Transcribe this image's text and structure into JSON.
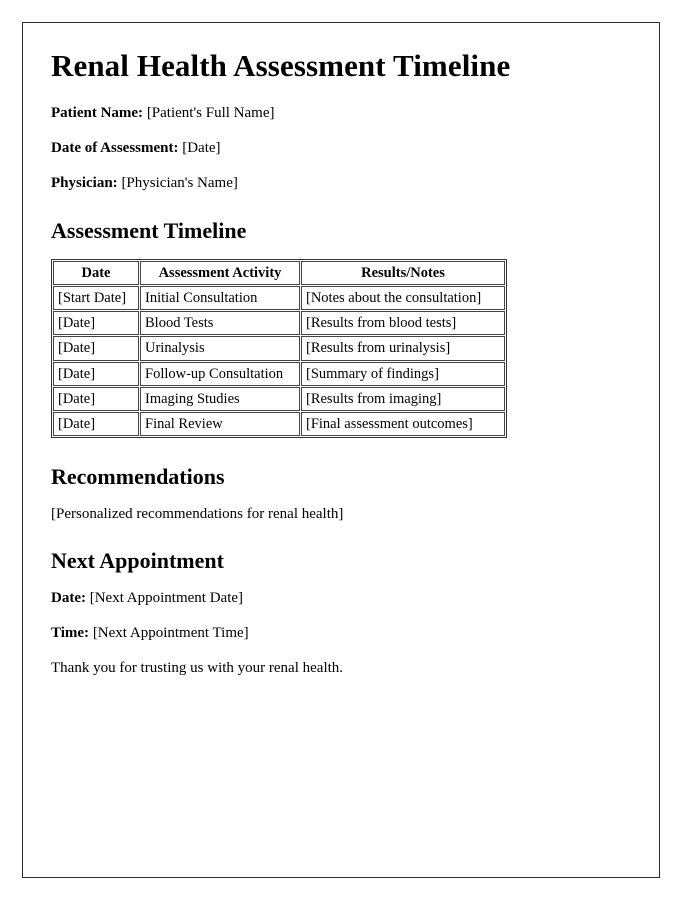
{
  "document": {
    "title": "Renal Health Assessment Timeline",
    "meta": [
      {
        "label": "Patient Name:",
        "value": "[Patient's Full Name]"
      },
      {
        "label": "Date of Assessment:",
        "value": "[Date]"
      },
      {
        "label": "Physician:",
        "value": "[Physician's Name]"
      }
    ],
    "timeline_section": {
      "heading": "Assessment Timeline",
      "table": {
        "columns": [
          "Date",
          "Assessment Activity",
          "Results/Notes"
        ],
        "rows": [
          [
            "[Start Date]",
            "Initial Consultation",
            "[Notes about the consultation]"
          ],
          [
            "[Date]",
            "Blood Tests",
            "[Results from blood tests]"
          ],
          [
            "[Date]",
            "Urinalysis",
            "[Results from urinalysis]"
          ],
          [
            "[Date]",
            "Follow-up Consultation",
            "[Summary of findings]"
          ],
          [
            "[Date]",
            "Imaging Studies",
            "[Results from imaging]"
          ],
          [
            "[Date]",
            "Final Review",
            "[Final assessment outcomes]"
          ]
        ]
      }
    },
    "recommendations_section": {
      "heading": "Recommendations",
      "body": "[Personalized recommendations for renal health]"
    },
    "next_appointment_section": {
      "heading": "Next Appointment",
      "fields": [
        {
          "label": "Date:",
          "value": "[Next Appointment Date]"
        },
        {
          "label": "Time:",
          "value": "[Next Appointment Time]"
        }
      ]
    },
    "closing": "Thank you for trusting us with your renal health."
  },
  "colors": {
    "text": "#000000",
    "page_border": "#2b2b2b",
    "table_border": "#444444",
    "background": "#ffffff"
  }
}
